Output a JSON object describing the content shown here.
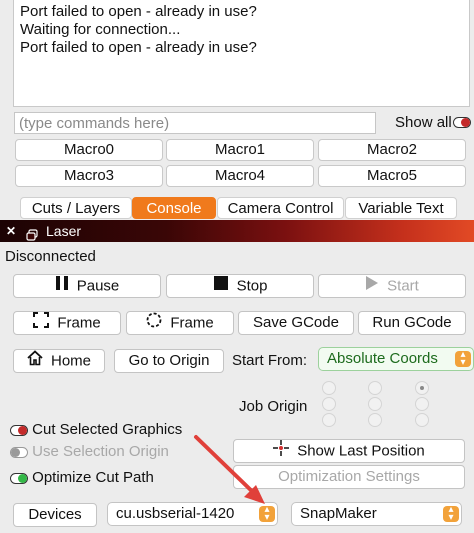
{
  "console": {
    "lines": [
      "Port failed to open - already in use?",
      "Waiting for connection...",
      "Port failed to open - already in use?"
    ],
    "command_placeholder": "(type commands here)",
    "show_all_label": "Show all",
    "macros": [
      "Macro0",
      "Macro1",
      "Macro2",
      "Macro3",
      "Macro4",
      "Macro5"
    ]
  },
  "tabs": [
    "Cuts / Layers",
    "Console",
    "Camera Control",
    "Variable Text"
  ],
  "active_tab": "Console",
  "laser": {
    "window_title": "Laser",
    "status": "Disconnected",
    "pause_label": "Pause",
    "stop_label": "Stop",
    "start_label": "Start",
    "frame_label": "Frame",
    "frame_circle_label": "Frame",
    "save_gcode_label": "Save GCode",
    "run_gcode_label": "Run GCode",
    "home_label": "Home",
    "go_to_origin_label": "Go to Origin",
    "start_from_label": "Start From:",
    "start_from_value": "Absolute Coords",
    "job_origin_label": "Job Origin",
    "cut_selected_label": "Cut Selected Graphics",
    "use_selection_origin_label": "Use Selection Origin",
    "show_last_position_label": "Show Last Position",
    "optimize_cut_path_label": "Optimize Cut Path",
    "optimization_settings_label": "Optimization Settings",
    "devices_label": "Devices",
    "port_value": "cu.usbserial-1420",
    "device_value": "SnapMaker"
  },
  "colors": {
    "accent": "#f07a1c",
    "annotation_arrow": "#e0403a",
    "toggle_on": "#33b847",
    "toggle_off_red": "#c42a2a"
  }
}
